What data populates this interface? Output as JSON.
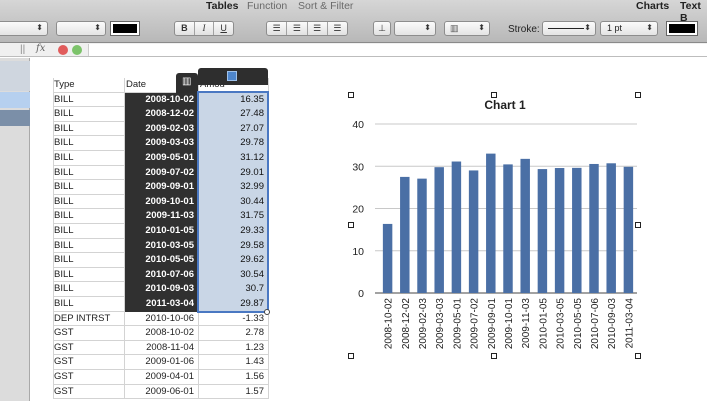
{
  "toolbar": {
    "tabs": [
      "Tables",
      "Function",
      "Sort & Filter",
      "Charts",
      "Text B"
    ],
    "bold_label": "B",
    "italic_label": "I",
    "underline_label": "U",
    "stroke_label": "Stroke:",
    "stroke_width": "1 pt"
  },
  "formula": {
    "fx": "fx"
  },
  "table": {
    "headers": [
      "Type",
      "Date",
      "Amou"
    ],
    "rows": [
      [
        "BILL",
        "2008-10-02",
        "16.35"
      ],
      [
        "BILL",
        "2008-12-02",
        "27.48"
      ],
      [
        "BILL",
        "2009-02-03",
        "27.07"
      ],
      [
        "BILL",
        "2009-03-03",
        "29.78"
      ],
      [
        "BILL",
        "2009-05-01",
        "31.12"
      ],
      [
        "BILL",
        "2009-07-02",
        "29.01"
      ],
      [
        "BILL",
        "2009-09-01",
        "32.99"
      ],
      [
        "BILL",
        "2009-10-01",
        "30.44"
      ],
      [
        "BILL",
        "2009-11-03",
        "31.75"
      ],
      [
        "BILL",
        "2010-01-05",
        "29.33"
      ],
      [
        "BILL",
        "2010-03-05",
        "29.58"
      ],
      [
        "BILL",
        "2010-05-05",
        "29.62"
      ],
      [
        "BILL",
        "2010-07-06",
        "30.54"
      ],
      [
        "BILL",
        "2010-09-03",
        "30.7"
      ],
      [
        "BILL",
        "2011-03-04",
        "29.87"
      ],
      [
        "DEP INTRST",
        "2010-10-06",
        "-1.33"
      ],
      [
        "GST",
        "2008-10-02",
        "2.78"
      ],
      [
        "GST",
        "2008-11-04",
        "1.23"
      ],
      [
        "GST",
        "2009-01-06",
        "1.43"
      ],
      [
        "GST",
        "2009-04-01",
        "1.56"
      ],
      [
        "GST",
        "2009-06-01",
        "1.57"
      ]
    ],
    "selected_rows": 15
  },
  "chart_data": {
    "type": "bar",
    "title": "Chart 1",
    "categories": [
      "2008-10-02",
      "2008-12-02",
      "2009-02-03",
      "2009-03-03",
      "2009-05-01",
      "2009-07-02",
      "2009-09-01",
      "2009-10-01",
      "2009-11-03",
      "2010-01-05",
      "2010-03-05",
      "2010-05-05",
      "2010-07-06",
      "2010-09-03",
      "2011-03-04"
    ],
    "values": [
      16.35,
      27.48,
      27.07,
      29.78,
      31.12,
      29.01,
      32.99,
      30.44,
      31.75,
      29.33,
      29.58,
      29.62,
      30.54,
      30.7,
      29.87
    ],
    "yticks": [
      "0",
      "10",
      "20",
      "30",
      "40"
    ],
    "ylim": [
      0,
      40
    ],
    "grid": true,
    "bar_color": "#4a6fa5"
  }
}
